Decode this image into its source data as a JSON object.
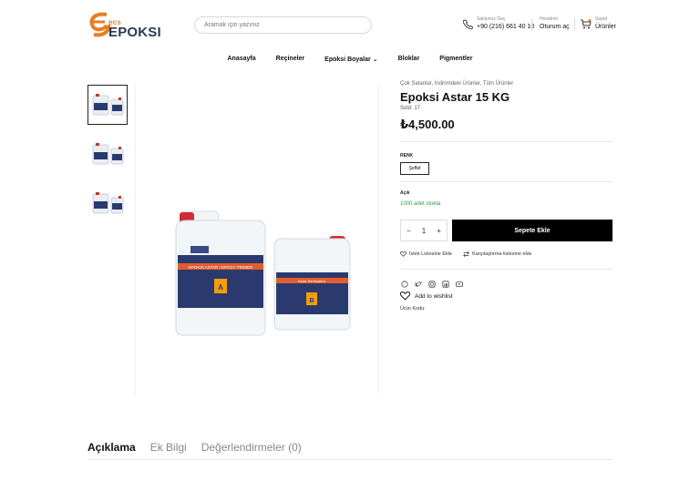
{
  "header": {
    "brand_prefix": "ecs",
    "brand_name": "EPOKSI",
    "search_placeholder": "Aramak için yazınız",
    "phone_label": "Satışımız Geç",
    "phone_number": "+90 (216) 661 40 10",
    "account_label": "Hesabım",
    "account_action": "Oturum aç",
    "cart_label": "Sepet",
    "cart_action": "Ürünler"
  },
  "nav": {
    "items": [
      "Anasayfa",
      "Reçineler",
      "Epoksi Boyalar ⌄",
      "Bloklar",
      "Pigmentler"
    ]
  },
  "product": {
    "breadcrumb": "Çok Satanlar, İndirimdeki Ürünler, Tüm Ürünler",
    "title": "Epoksi Astar 15 KG",
    "sold": "Sold: 17",
    "price": "₺4,500.00",
    "option_label": "RENK",
    "option_value": "Şeffaf",
    "stock_label": "Açık",
    "stock_value": "1000 adet stokta",
    "quantity": "1",
    "qty_minus": "−",
    "qty_plus": "+",
    "add_to_cart": "Sepete Ekle",
    "wishlist_action": "İstek Listesine Ekle",
    "compare_action": "Karşılaştırma listesine ekle",
    "add_wishlist": "Add to wishlist",
    "product_code_label": "Ürün Kodu:"
  },
  "product_image": {
    "big_label_top": "EPOKSİ ASTAR / EPOXY PRIMER",
    "big_label_mark": "A",
    "small_label_top": "Astar Sertleştirici",
    "small_label_mark": "B"
  },
  "tabs": [
    "Açıklama",
    "Ek Bilgi",
    "Değerlendirmeler (0)"
  ],
  "colors": {
    "brand_orange": "#e67e22",
    "brand_navy": "#2b3a55",
    "stock_green": "#2e9a4b",
    "button_black": "#000000"
  }
}
